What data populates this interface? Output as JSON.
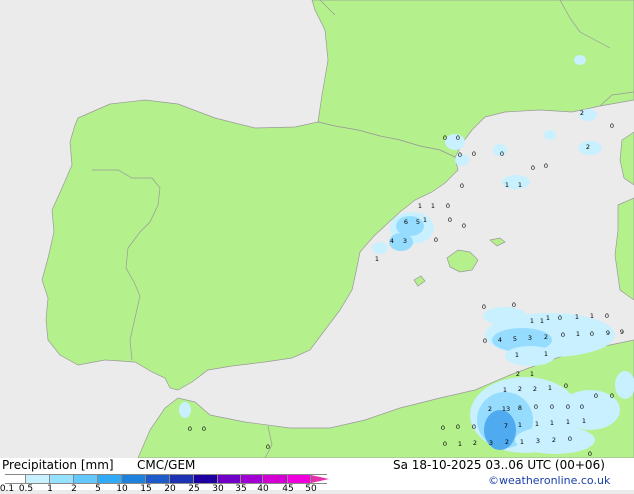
{
  "header": {
    "title": "Precipitation [mm]",
    "model": "CMC/GEM",
    "datetime": "Sa 18-10-2025 03..06 UTC (00+06)",
    "credit": "©weatheronline.co.uk"
  },
  "legend": {
    "labels": [
      "0.1",
      "0.5",
      "1",
      "2",
      "5",
      "10",
      "15",
      "20",
      "25",
      "30",
      "35",
      "40",
      "45",
      "50"
    ],
    "colors": [
      "#ffffff",
      "#c8f0ff",
      "#96e1ff",
      "#64c8fa",
      "#32aaf5",
      "#1e82dc",
      "#1e5ac8",
      "#1e32b4",
      "#1e00a0",
      "#6e00c8",
      "#a000d2",
      "#d200d2",
      "#f000dc",
      "#e632aa"
    ]
  },
  "colors": {
    "land": "#b4f08c",
    "sea": "#ebebeb",
    "border": "#999999",
    "rain_light": "#c8f0ff",
    "rain_mid": "#96dcff",
    "rain_heavy": "#50aaf0"
  },
  "map_labels": [
    {
      "t": "0"
    },
    {
      "t": "0"
    },
    {
      "t": "2"
    },
    {
      "t": "0"
    },
    {
      "t": "0"
    },
    {
      "t": "0"
    },
    {
      "t": "0"
    },
    {
      "t": "0"
    },
    {
      "t": "0"
    },
    {
      "t": "0"
    },
    {
      "t": "1"
    },
    {
      "t": "1"
    },
    {
      "t": "2"
    },
    {
      "t": "1"
    },
    {
      "t": "0"
    },
    {
      "t": "0"
    },
    {
      "t": "1"
    },
    {
      "t": "1"
    },
    {
      "t": "6"
    },
    {
      "t": "5"
    },
    {
      "t": "1"
    },
    {
      "t": "0"
    },
    {
      "t": "4"
    },
    {
      "t": "3"
    },
    {
      "t": "0"
    },
    {
      "t": "1"
    },
    {
      "t": "0"
    },
    {
      "t": "0"
    },
    {
      "t": "1"
    },
    {
      "t": "1"
    },
    {
      "t": "0"
    },
    {
      "t": "1"
    },
    {
      "t": "1"
    },
    {
      "t": "0"
    },
    {
      "t": "9"
    },
    {
      "t": "0"
    },
    {
      "t": "4"
    },
    {
      "t": "5"
    },
    {
      "t": "3"
    },
    {
      "t": "2"
    },
    {
      "t": "0"
    },
    {
      "t": "1"
    },
    {
      "t": "0"
    },
    {
      "t": "9"
    },
    {
      "t": "1"
    },
    {
      "t": "1"
    },
    {
      "t": "2"
    },
    {
      "t": "1"
    },
    {
      "t": "1"
    },
    {
      "t": "2"
    },
    {
      "t": "2"
    },
    {
      "t": "1"
    },
    {
      "t": "0"
    },
    {
      "t": "2"
    },
    {
      "t": "13"
    },
    {
      "t": "8"
    },
    {
      "t": "0"
    },
    {
      "t": "0"
    },
    {
      "t": "0"
    },
    {
      "t": "0"
    },
    {
      "t": "0"
    },
    {
      "t": "0"
    },
    {
      "t": "0"
    },
    {
      "t": "0"
    },
    {
      "t": "7"
    },
    {
      "t": "1"
    },
    {
      "t": "1"
    },
    {
      "t": "1"
    },
    {
      "t": "1"
    },
    {
      "t": "1"
    },
    {
      "t": "0"
    },
    {
      "t": "0"
    },
    {
      "t": "1"
    },
    {
      "t": "2"
    },
    {
      "t": "3"
    },
    {
      "t": "2"
    },
    {
      "t": "1"
    },
    {
      "t": "3"
    },
    {
      "t": "2"
    },
    {
      "t": "0"
    },
    {
      "t": "0"
    },
    {
      "t": "0"
    },
    {
      "t": "0"
    },
    {
      "t": "0"
    }
  ]
}
